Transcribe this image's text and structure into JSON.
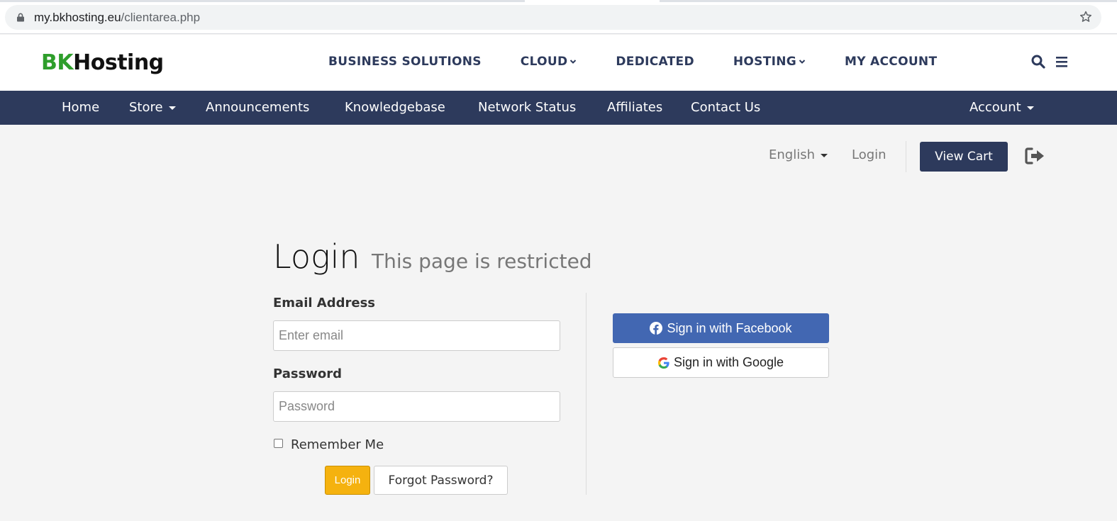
{
  "browser": {
    "url_host": "my.bkhosting.eu",
    "url_path": "/clientarea.php"
  },
  "header": {
    "logo_bk": "BK",
    "logo_hosting": "Hosting",
    "nav": [
      {
        "label": "BUSINESS SOLUTIONS"
      },
      {
        "label": "CLOUD"
      },
      {
        "label": "DEDICATED"
      },
      {
        "label": "HOSTING"
      },
      {
        "label": "MY ACCOUNT"
      }
    ],
    "icons": [
      "search-icon",
      "menu-icon"
    ]
  },
  "subnav": {
    "items": [
      {
        "label": "Home"
      },
      {
        "label": "Store"
      },
      {
        "label": "Announcements"
      },
      {
        "label": "Knowledgebase"
      },
      {
        "label": "Network Status"
      },
      {
        "label": "Affiliates"
      },
      {
        "label": "Contact Us"
      }
    ],
    "account": "Account"
  },
  "toolbar": {
    "language": "English",
    "login": "Login",
    "view_cart": "View Cart"
  },
  "login": {
    "title": "Login",
    "subtitle": "This page is restricted",
    "email_label": "Email Address",
    "email_placeholder": "Enter email",
    "password_label": "Password",
    "password_placeholder": "Password",
    "remember_me": "Remember Me",
    "login_button": "Login",
    "forgot_button": "Forgot Password?",
    "facebook_button": "Sign in with Facebook",
    "google_button": "Sign in with Google"
  },
  "colors": {
    "navy": "#2d3a5c",
    "brand_green": "#2e9e2b",
    "login_orange": "#f5b20f",
    "facebook_blue": "#4267b2"
  }
}
